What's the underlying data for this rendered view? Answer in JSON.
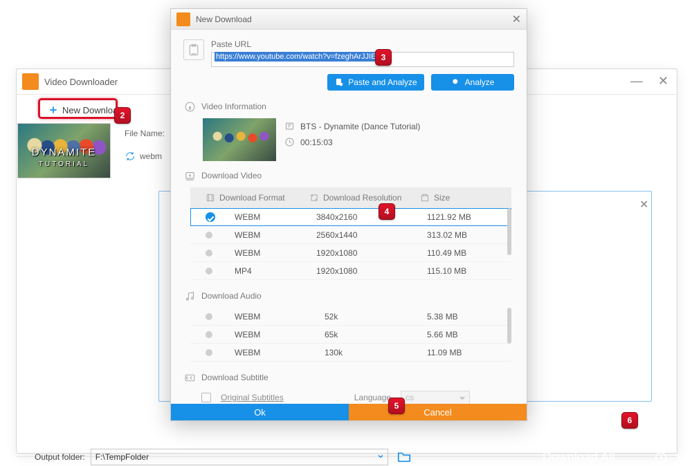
{
  "app": {
    "title": "Video Downloader"
  },
  "toolbar": {
    "new_download": "New Download"
  },
  "main_row": {
    "file_name_label": "File Name:",
    "webm_label": "webm",
    "thumb_title": "DYNAMITE",
    "thumb_sub": "TUTORIAL"
  },
  "footer": {
    "output_label": "Output folder:",
    "output_path": "F:\\TempFolder",
    "download_all": "Download All"
  },
  "dialog": {
    "title": "New Download",
    "paste_url_label": "Paste URL",
    "url_value": "https://www.youtube.com/watch?v=fzeghArJJIE",
    "paste_analyze": "Paste and Analyze",
    "analyze": "Analyze",
    "video_info_label": "Video Information",
    "video_title": "BTS - Dynamite (Dance Tutorial)",
    "video_duration": "00:15:03",
    "download_video_label": "Download Video",
    "col_format": "Download Format",
    "col_resolution": "Download Resolution",
    "col_size": "Size",
    "video_rows": [
      {
        "format": "WEBM",
        "resolution": "3840x2160",
        "size": "1121.92 MB",
        "selected": true
      },
      {
        "format": "WEBM",
        "resolution": "2560x1440",
        "size": "313.02 MB",
        "selected": false
      },
      {
        "format": "WEBM",
        "resolution": "1920x1080",
        "size": "110.49 MB",
        "selected": false
      },
      {
        "format": "MP4",
        "resolution": "1920x1080",
        "size": "115.10 MB",
        "selected": false
      }
    ],
    "download_audio_label": "Download Audio",
    "audio_rows": [
      {
        "format": "WEBM",
        "resolution": "52k",
        "size": "5.38 MB"
      },
      {
        "format": "WEBM",
        "resolution": "65k",
        "size": "5.66 MB"
      },
      {
        "format": "WEBM",
        "resolution": "130k",
        "size": "11.09 MB"
      }
    ],
    "download_subtitle_label": "Download Subtitle",
    "original_subtitles": "Original Subtitles",
    "language_label": "Language",
    "language_value": "cs",
    "ok": "Ok",
    "cancel": "Cancel"
  },
  "badges": {
    "2": "2",
    "3": "3",
    "4": "4",
    "5": "5",
    "6": "6"
  }
}
